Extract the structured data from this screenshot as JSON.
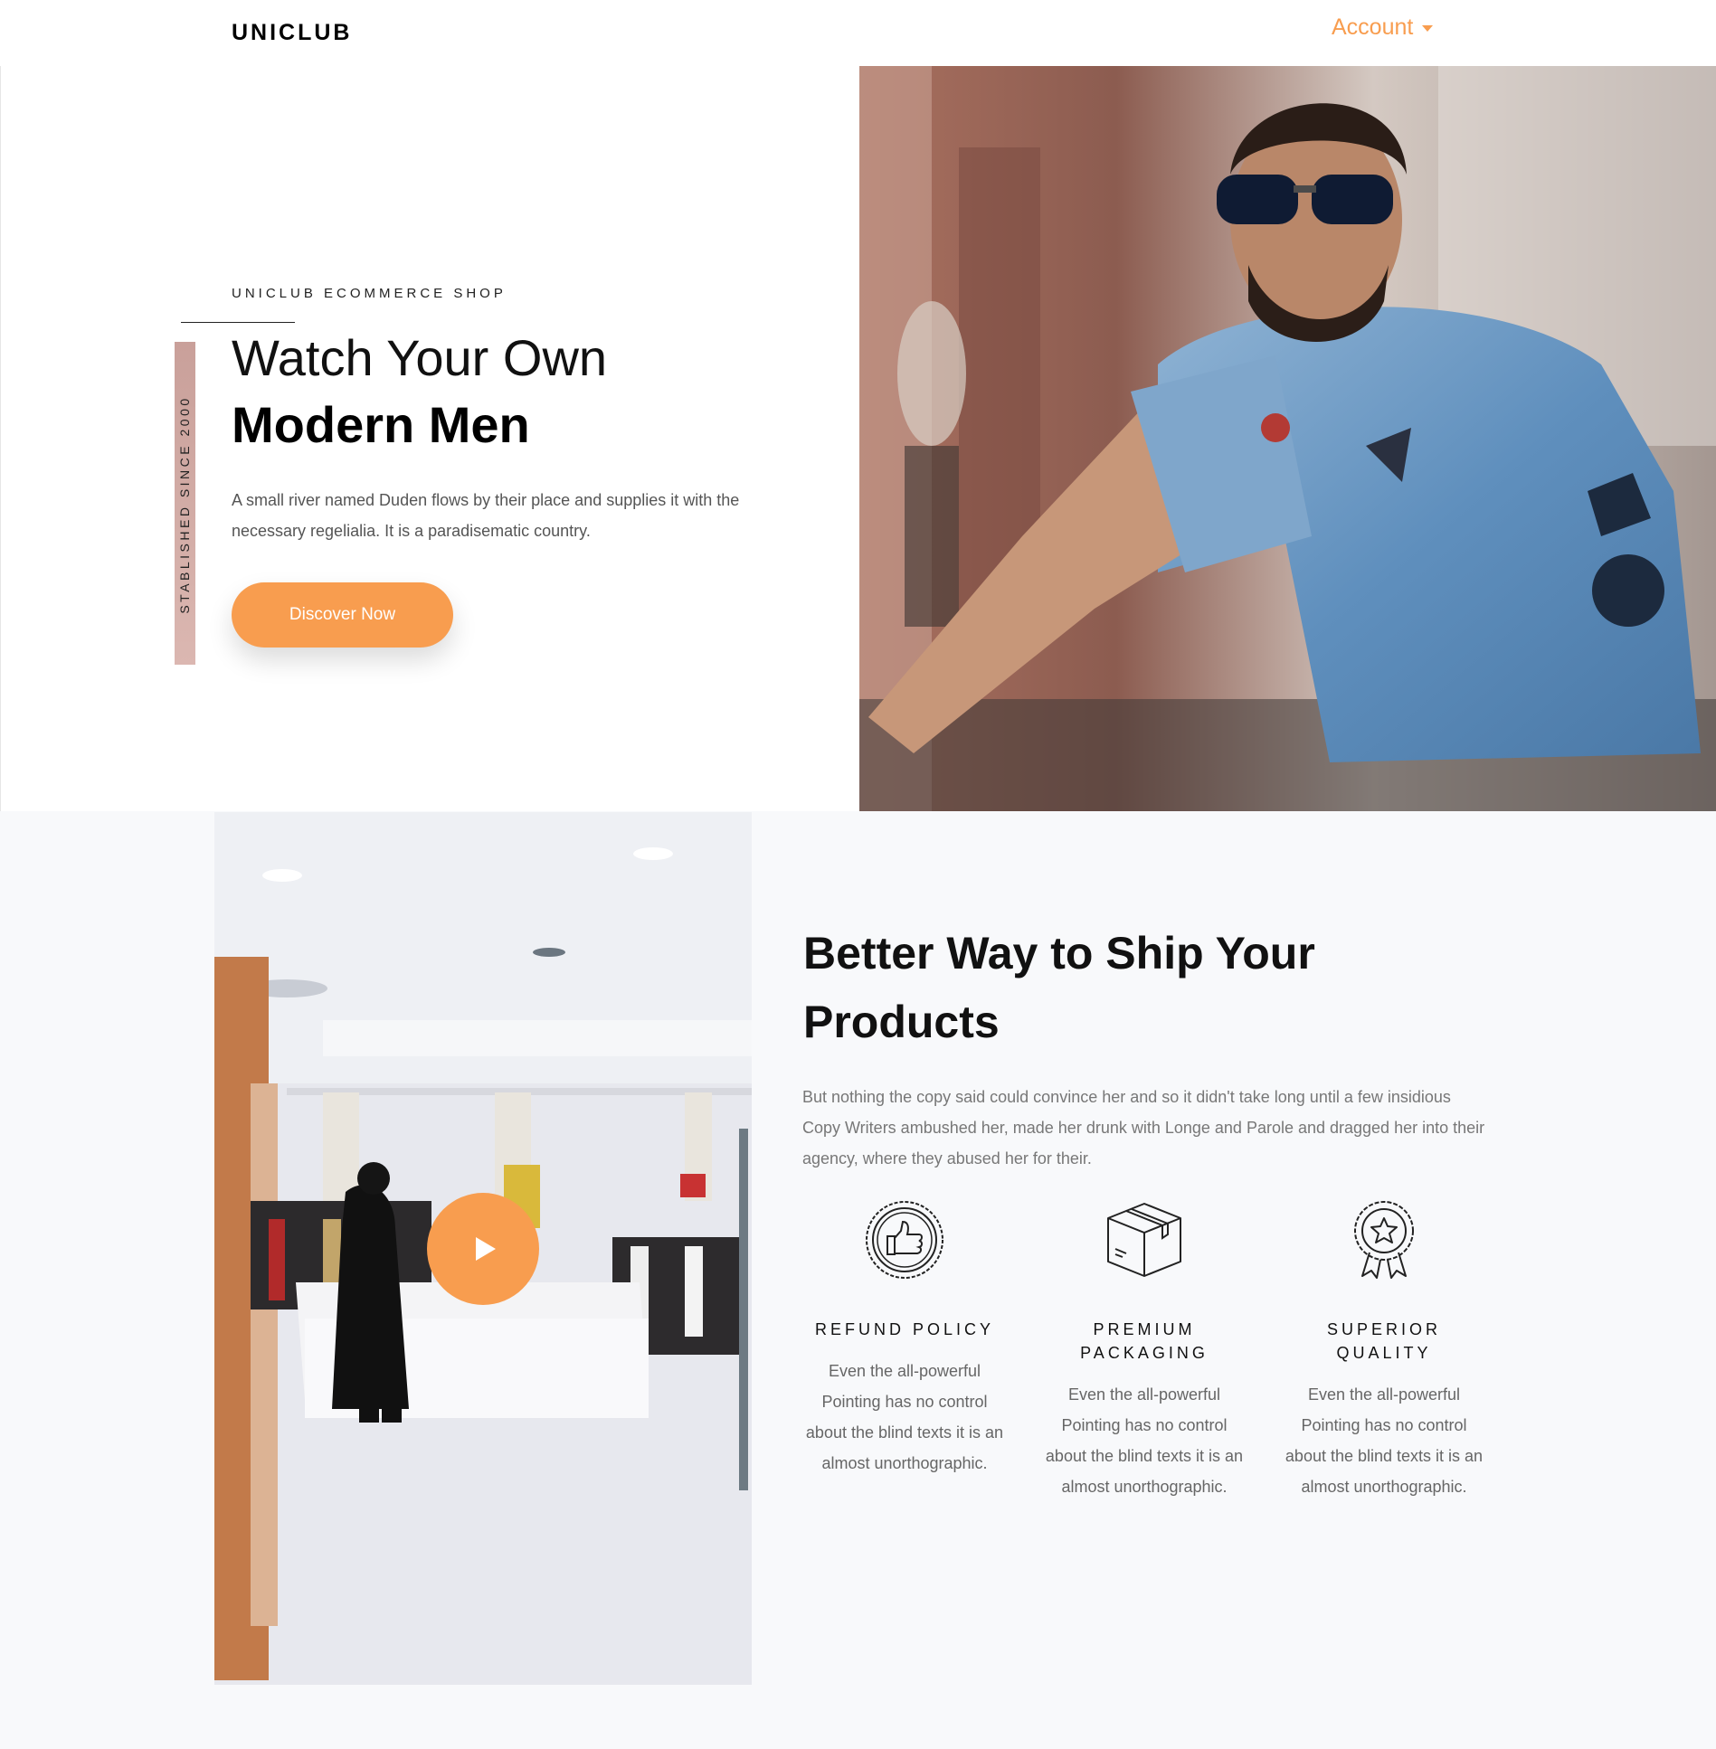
{
  "navbar": {
    "brand": "UNICLUB",
    "account_label": "Account"
  },
  "hero": {
    "established": "STABLISHED SINCE 2000",
    "subtitle": "UNICLUB ECOMMERCE SHOP",
    "title_line1": "Watch Your Own",
    "title_line2": "Modern Men",
    "description": "A small river named Duden flows by their place and supplies it with the necessary regelialia. It is a paradisematic country.",
    "cta_label": "Discover Now"
  },
  "section2": {
    "title": "Better Way to Ship Your Products",
    "description": "But nothing the copy said could convince her and so it didn't take long until a few insidious Copy Writers ambushed her, made her drunk with Longe and Parole and dragged her into their agency, where they abused her for their.",
    "features": [
      {
        "icon": "thumbs-up-badge-icon",
        "title": "REFUND POLICY",
        "description": "Even the all-powerful Pointing has no control about the blind texts it is an almost unorthographic."
      },
      {
        "icon": "package-box-icon",
        "title": "PREMIUM PACKAGING",
        "description": "Even the all-powerful Pointing has no control about the blind texts it is an almost unorthographic."
      },
      {
        "icon": "award-ribbon-icon",
        "title": "SUPERIOR QUALITY",
        "description": "Even the all-powerful Pointing has no control about the blind texts it is an almost unorthographic."
      }
    ]
  },
  "colors": {
    "accent": "#f89d4f",
    "section_bg": "#f8f9fb",
    "est_bar": "#d4aca6"
  }
}
